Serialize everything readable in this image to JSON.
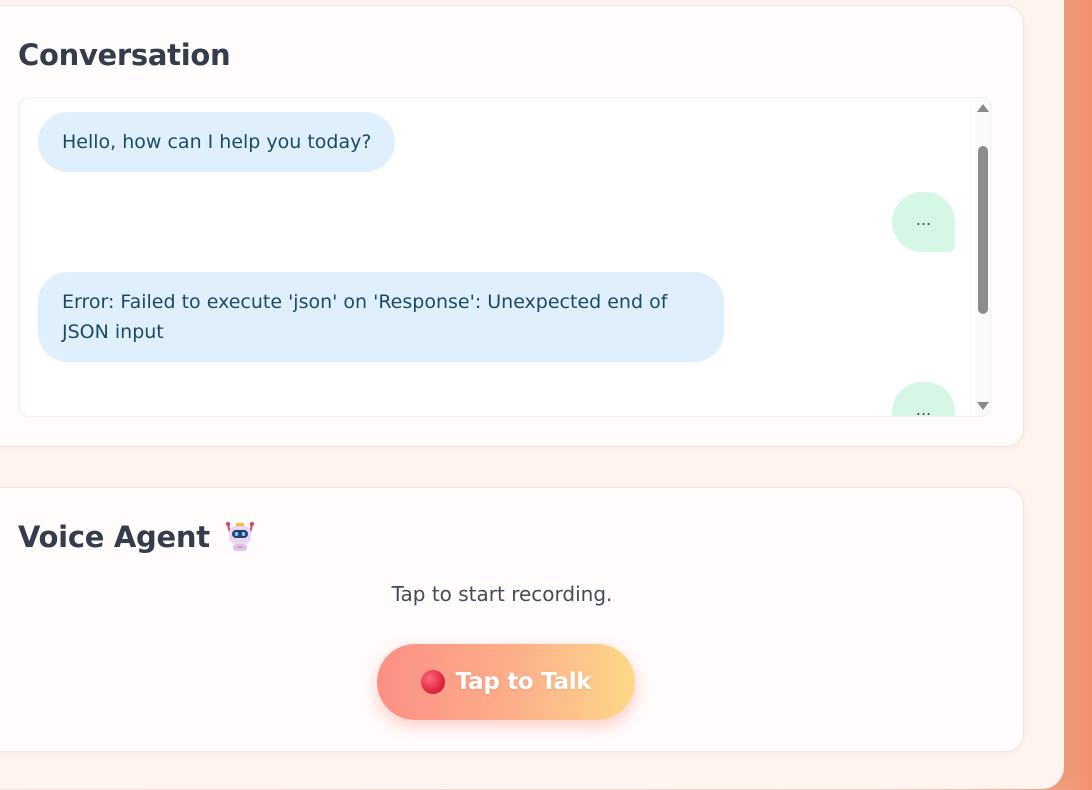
{
  "conversation": {
    "title": "Conversation",
    "messages": [
      {
        "role": "agent",
        "text": "Hello, how can I help you today?"
      },
      {
        "role": "user",
        "text": "..."
      },
      {
        "role": "agent",
        "text": "Error: Failed to execute 'json' on 'Response': Unexpected end of JSON input"
      },
      {
        "role": "user",
        "text": "..."
      }
    ]
  },
  "voice_agent": {
    "title": "Voice Agent",
    "title_icon": "robot-icon",
    "status": "Tap to start recording.",
    "button_label": "Tap to Talk",
    "button_icon": "red-circle-icon"
  },
  "colors": {
    "agent_bubble": "#dff0fc",
    "user_bubble": "#d6f7e6",
    "button_gradient_start": "#fc8f85",
    "button_gradient_end": "#fed889",
    "title_text": "#353c4c"
  }
}
